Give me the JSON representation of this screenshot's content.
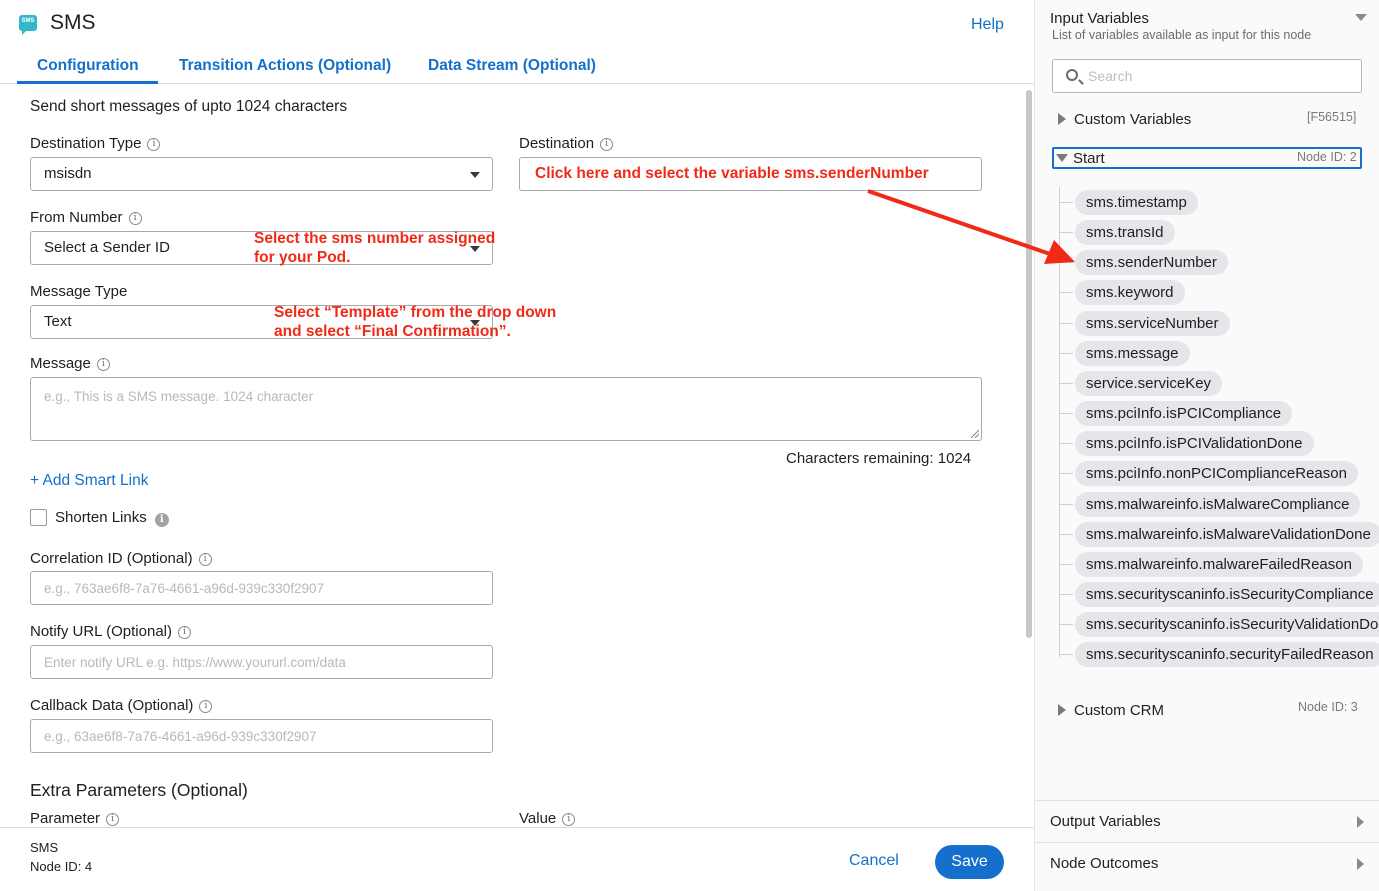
{
  "header": {
    "app_icon_text": "SMS",
    "title": "SMS",
    "help": "Help",
    "tabs": [
      {
        "label": "Configuration"
      },
      {
        "label": "Transition Actions (Optional)"
      },
      {
        "label": "Data Stream (Optional)"
      }
    ]
  },
  "form": {
    "description": "Send short messages of upto 1024 characters",
    "destination_type": {
      "label": "Destination Type",
      "value": "msisdn"
    },
    "destination": {
      "label": "Destination"
    },
    "from_number": {
      "label": "From Number",
      "value": "Select a Sender ID"
    },
    "message_type": {
      "label": "Message Type",
      "value": "Text"
    },
    "message": {
      "label": "Message",
      "placeholder": "e.g., This is a SMS message. 1024 character"
    },
    "characters_remaining": "Characters remaining: 1024",
    "add_smart_link": "+ Add Smart Link",
    "shorten_links": "Shorten Links",
    "correlation_id": {
      "label": "Correlation ID (Optional)",
      "placeholder": "e.g., 763ae6f8-7a76-4661-a96d-939c330f2907"
    },
    "notify_url": {
      "label": "Notify URL (Optional)",
      "placeholder": "Enter notify URL e.g. https://www.yoururl.com/data"
    },
    "callback_data": {
      "label": "Callback Data (Optional)",
      "placeholder": "e.g., 63ae6f8-7a76-4661-a96d-939c330f2907"
    },
    "extra_parameters": {
      "title": "Extra Parameters (Optional)",
      "parameter_label": "Parameter",
      "value_label": "Value"
    }
  },
  "annotations": {
    "destination": "Click here and select the variable sms.senderNumber",
    "from_number_line1": "Select the sms number assigned",
    "from_number_line2": "for your Pod.",
    "message_type_line1": "Select “Template” from the drop down",
    "message_type_line2": "and select “Final Confirmation”.",
    "color": "#f02a17"
  },
  "footer": {
    "node_name": "SMS",
    "node_id": "Node ID: 4",
    "cancel": "Cancel",
    "save": "Save"
  },
  "input_variables": {
    "title": "Input Variables",
    "subtitle": "List of variables available as input for this node",
    "search_placeholder": "Search",
    "custom_variables": {
      "label": "Custom Variables",
      "meta": "[F56515]"
    },
    "start": {
      "label": "Start",
      "meta": "Node ID: 2"
    },
    "variables": [
      "sms.timestamp",
      "sms.transId",
      "sms.senderNumber",
      "sms.keyword",
      "sms.serviceNumber",
      "sms.message",
      "service.serviceKey",
      "sms.pciInfo.isPCICompliance",
      "sms.pciInfo.isPCIValidationDone",
      "sms.pciInfo.nonPCIComplianceReason",
      "sms.malwareinfo.isMalwareCompliance",
      "sms.malwareinfo.isMalwareValidationDone",
      "sms.malwareinfo.malwareFailedReason",
      "sms.securityscaninfo.isSecurityCompliance",
      "sms.securityscaninfo.isSecurityValidationDone",
      "sms.securityscaninfo.securityFailedReason"
    ],
    "custom_crm": {
      "label": "Custom CRM",
      "meta": "Node ID: 3"
    }
  },
  "output_variables": {
    "label": "Output Variables"
  },
  "node_outcomes": {
    "label": "Node Outcomes"
  },
  "colors": {
    "accent": "#1470cc",
    "annotation": "#f02a17",
    "chip": "#e6e6ea"
  }
}
